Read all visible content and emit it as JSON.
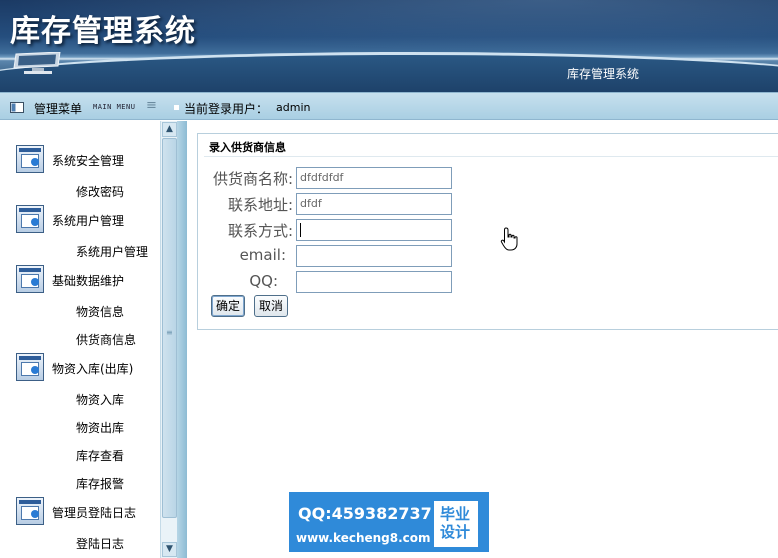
{
  "app": {
    "title": "库存管理系统",
    "header_subtitle": "库存管理系统"
  },
  "toolbar": {
    "menu_title": "管理菜单",
    "menu_subtitle": "MAIN MENU",
    "current_user_label": "当前登录用户：",
    "current_user": "admin"
  },
  "sidebar": {
    "groups": [
      {
        "label": "系统安全管理",
        "icon": "app-window-icon",
        "items": [
          "修改密码"
        ]
      },
      {
        "label": "系统用户管理",
        "icon": "app-window-icon",
        "items": [
          "系统用户管理"
        ]
      },
      {
        "label": "基础数据维护",
        "icon": "app-window-icon",
        "items": [
          "物资信息",
          "供货商信息"
        ]
      },
      {
        "label": "物资入库(出库)",
        "icon": "app-window-icon",
        "items": [
          "物资入库",
          "物资出库",
          "库存查看",
          "库存报警"
        ]
      },
      {
        "label": "管理员登陆日志",
        "icon": "app-window-icon",
        "items": [
          "登陆日志"
        ]
      }
    ]
  },
  "form": {
    "title": "录入供货商信息",
    "fields": [
      {
        "label": "供货商名称:",
        "value": "dfdfdfdf"
      },
      {
        "label": "联系地址:",
        "value": "dfdf"
      },
      {
        "label": "联系方式:",
        "value": ""
      },
      {
        "label": "email:",
        "value": ""
      },
      {
        "label": "QQ:",
        "value": ""
      }
    ],
    "submit_label": "确定",
    "cancel_label": "取消"
  },
  "watermark": {
    "qq": "QQ:459382737",
    "url": "www.kecheng8.com",
    "badge_line1": "毕业",
    "badge_line2": "设计"
  },
  "colors": {
    "header_dark": "#1b3a64",
    "toolbar": "#b8d8ea",
    "divider": "#9ec7dc",
    "watermark": "#2f8ad9"
  }
}
